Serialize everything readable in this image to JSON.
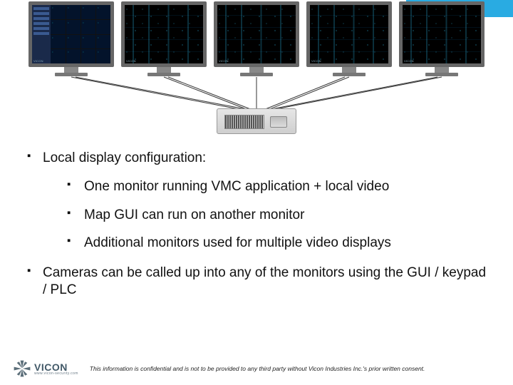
{
  "bullets": {
    "b1": "Local display configuration:",
    "b1a": "One monitor running VMC application + local video",
    "b1b": "Map GUI can run on another monitor",
    "b1c": "Additional monitors used for multiple video displays",
    "b2": "Cameras can be called up into any of the monitors using the GUI / keypad / PLC"
  },
  "logo": {
    "brand": "VICON",
    "site": "www.vicon-security.com"
  },
  "footer": {
    "disclaimer": "This information is confidential and is not to be provided to any third party without Vicon Industries Inc.'s prior written consent."
  },
  "monitor_brand": "VICON"
}
